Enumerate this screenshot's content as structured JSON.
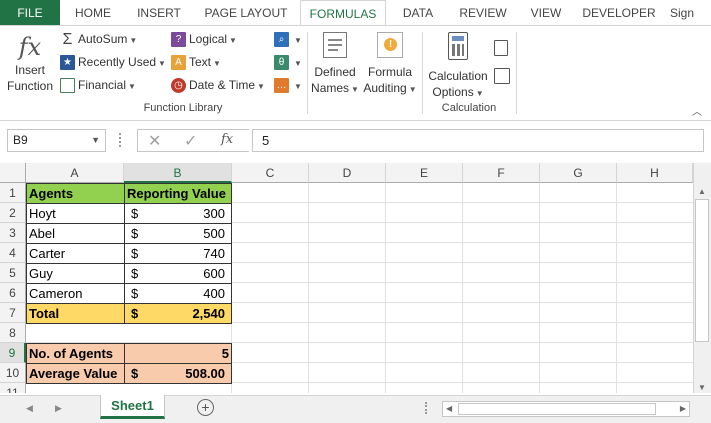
{
  "tabs": [
    "FILE",
    "HOME",
    "INSERT",
    "PAGE LAYOUT",
    "FORMULAS",
    "DATA",
    "REVIEW",
    "VIEW",
    "DEVELOPER",
    "Sign"
  ],
  "ribbon": {
    "insert_function": [
      "Insert",
      "Function"
    ],
    "library": {
      "autosum": "AutoSum",
      "recently_used": "Recently Used",
      "financial": "Financial",
      "logical": "Logical",
      "text": "Text",
      "date_time": "Date & Time",
      "group_label": "Function Library"
    },
    "defined_names": [
      "Defined",
      "Names"
    ],
    "formula_auditing": [
      "Formula",
      "Auditing"
    ],
    "calculation_options": [
      "Calculation",
      "Options"
    ],
    "calculation_label": "Calculation",
    "fx_symbol": "fx"
  },
  "formula_bar": {
    "name_box": "B9",
    "value": "5",
    "fx": "fx"
  },
  "columns": [
    "A",
    "B",
    "C",
    "D",
    "E",
    "F",
    "G",
    "H"
  ],
  "rows": [
    "1",
    "2",
    "3",
    "4",
    "5",
    "6",
    "7",
    "8",
    "9",
    "10",
    "11"
  ],
  "sheet": {
    "header": {
      "agents": "Agents",
      "reporting_value": "Reporting Value"
    },
    "data": [
      {
        "agent": "Hoyt",
        "cur": "$",
        "value": "300"
      },
      {
        "agent": "Abel",
        "cur": "$",
        "value": "500"
      },
      {
        "agent": "Carter",
        "cur": "$",
        "value": "740"
      },
      {
        "agent": "Guy",
        "cur": "$",
        "value": "600"
      },
      {
        "agent": "Cameron",
        "cur": "$",
        "value": "400"
      }
    ],
    "total": {
      "label": "Total",
      "cur": "$",
      "value": "2,540"
    },
    "no_agents": {
      "label": "No. of Agents",
      "value": "5"
    },
    "average": {
      "label": "Average Value",
      "cur": "$",
      "value": "508.00"
    }
  },
  "sheet_tab": "Sheet1",
  "colors": {
    "green": "#92d050",
    "yellow": "#ffd966",
    "orange": "#f8cbad",
    "excel_green": "#217346"
  }
}
